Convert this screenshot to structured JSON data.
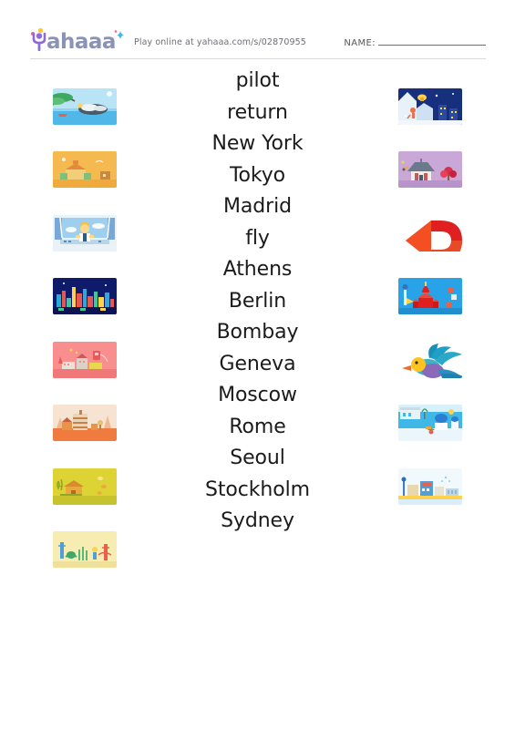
{
  "header": {
    "logo_text": "ahaaa",
    "logo_name": "Yahaaa",
    "play_text": "Play online at yahaaa.com/s/02870955",
    "name_label": "NAME:",
    "name_value": ""
  },
  "words": [
    "pilot",
    "return",
    "New York",
    "Tokyo",
    "Madrid",
    "fly",
    "Athens",
    "Berlin",
    "Bombay",
    "Geneva",
    "Moscow",
    "Rome",
    "Seoul",
    "Stockholm",
    "Sydney"
  ],
  "left_images": [
    {
      "name": "beach-island-illustration",
      "alt": "tropical beach with palm tree, boat and rocks",
      "bg": "#aee0f2"
    },
    {
      "name": "madrid-buildings-illustration",
      "alt": "orange plaza buildings",
      "bg": "#f4b74f"
    },
    {
      "name": "pilot-cockpit-illustration",
      "alt": "pilot sitting in airplane cockpit",
      "bg": "#cfe6f7"
    },
    {
      "name": "night-city-skyline-illustration",
      "alt": "colorful night city skyline",
      "bg": "#101a6b"
    },
    {
      "name": "pink-city-illustration",
      "alt": "pink cityscape with buildings",
      "bg": "#f98a8a"
    },
    {
      "name": "rome-colosseum-illustration",
      "alt": "orange roman colosseum scene",
      "bg": "#f07b3f"
    },
    {
      "name": "yellow-temple-illustration",
      "alt": "yellow field with temple and bees",
      "bg": "#ddd334"
    },
    {
      "name": "golden-gate-illustration",
      "alt": "cream scene with golden gate bridge",
      "bg": "#f5e8a8"
    }
  ],
  "right_images": [
    {
      "name": "winter-night-village-illustration",
      "alt": "dark blue snowy night village",
      "bg": "#17307e"
    },
    {
      "name": "pagoda-temple-illustration",
      "alt": "purple scene with pagoda and red tree",
      "bg": "#c9a8d8"
    },
    {
      "name": "return-arrow-icon",
      "alt": "red u-turn return arrow",
      "bg": "transparent"
    },
    {
      "name": "moscow-kremlin-illustration",
      "alt": "blue scene with red kremlin towers",
      "bg": "#29a3e8"
    },
    {
      "name": "flying-bird-icon",
      "alt": "blue bird flying",
      "bg": "transparent"
    },
    {
      "name": "greek-island-illustration",
      "alt": "greek island white houses by the sea",
      "bg": "#3fb8e8"
    },
    {
      "name": "waterfront-city-illustration",
      "alt": "blue waterfront city with buildings",
      "bg": "#e8f4fb"
    }
  ],
  "colors": {
    "logo_purple": "#8f6bd8",
    "logo_gray": "#8a93b5",
    "accent_pink": "#ff5a8a",
    "accent_yellow": "#ffc633",
    "rule": "#d8d8dd",
    "word_text": "#1b1b1b"
  }
}
